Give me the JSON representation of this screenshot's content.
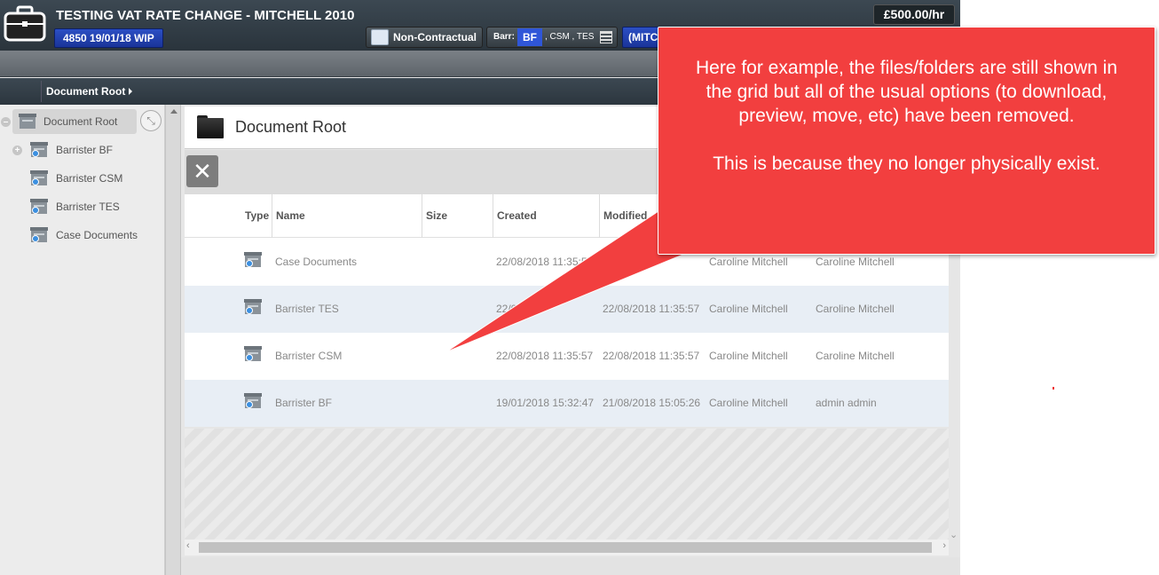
{
  "header": {
    "case_title": "TESTING VAT RATE CHANGE - MITCHELL 2010",
    "case_ref": "4850 19/01/18 WIP",
    "rate": "£500.00/hr",
    "contract_label": "Non-Contractual",
    "barr_label": "Barr:",
    "barr_selected": "BF",
    "barr_others": ", CSM , TES",
    "client_label": "(MITC"
  },
  "breadcrumb": {
    "label": "Document Root"
  },
  "tree": {
    "root": "Document Root",
    "items": [
      {
        "label": "Barrister BF",
        "expandable": true
      },
      {
        "label": "Barrister CSM",
        "expandable": false
      },
      {
        "label": "Barrister TES",
        "expandable": false
      },
      {
        "label": "Case Documents",
        "expandable": false
      }
    ]
  },
  "main": {
    "title": "Document Root",
    "close_glyph": "✕",
    "columns": [
      "Type",
      "Name",
      "Size",
      "Created",
      "Modified"
    ],
    "rows": [
      {
        "name": "Case Documents",
        "size": "",
        "created": "22/08/2018 11:35:57",
        "modified": "",
        "created_by": "Caroline Mitchell",
        "modified_by": "Caroline Mitchell"
      },
      {
        "name": "Barrister TES",
        "size": "",
        "created": "22/0",
        "modified": "22/08/2018 11:35:57",
        "created_by": "Caroline Mitchell",
        "modified_by": "Caroline Mitchell"
      },
      {
        "name": "Barrister CSM",
        "size": "",
        "created": "22/08/2018 11:35:57",
        "modified": "22/08/2018 11:35:57",
        "created_by": "Caroline Mitchell",
        "modified_by": "Caroline Mitchell"
      },
      {
        "name": "Barrister BF",
        "size": "",
        "created": "19/01/2018 15:32:47",
        "modified": "21/08/2018 15:05:26",
        "created_by": "Caroline Mitchell",
        "modified_by": "admin admin"
      }
    ]
  },
  "callout": {
    "paragraph1": "Here for example, the files/folders are still shown in the grid but all of the usual options (to download, preview, move, etc) have been removed.",
    "paragraph2": "This is because they no longer physically exist."
  },
  "colors": {
    "callout": "#f23f3f",
    "header_dark": "#2f3a42",
    "accent_blue": "#2f56d8",
    "row_alt": "#e8eef5"
  }
}
